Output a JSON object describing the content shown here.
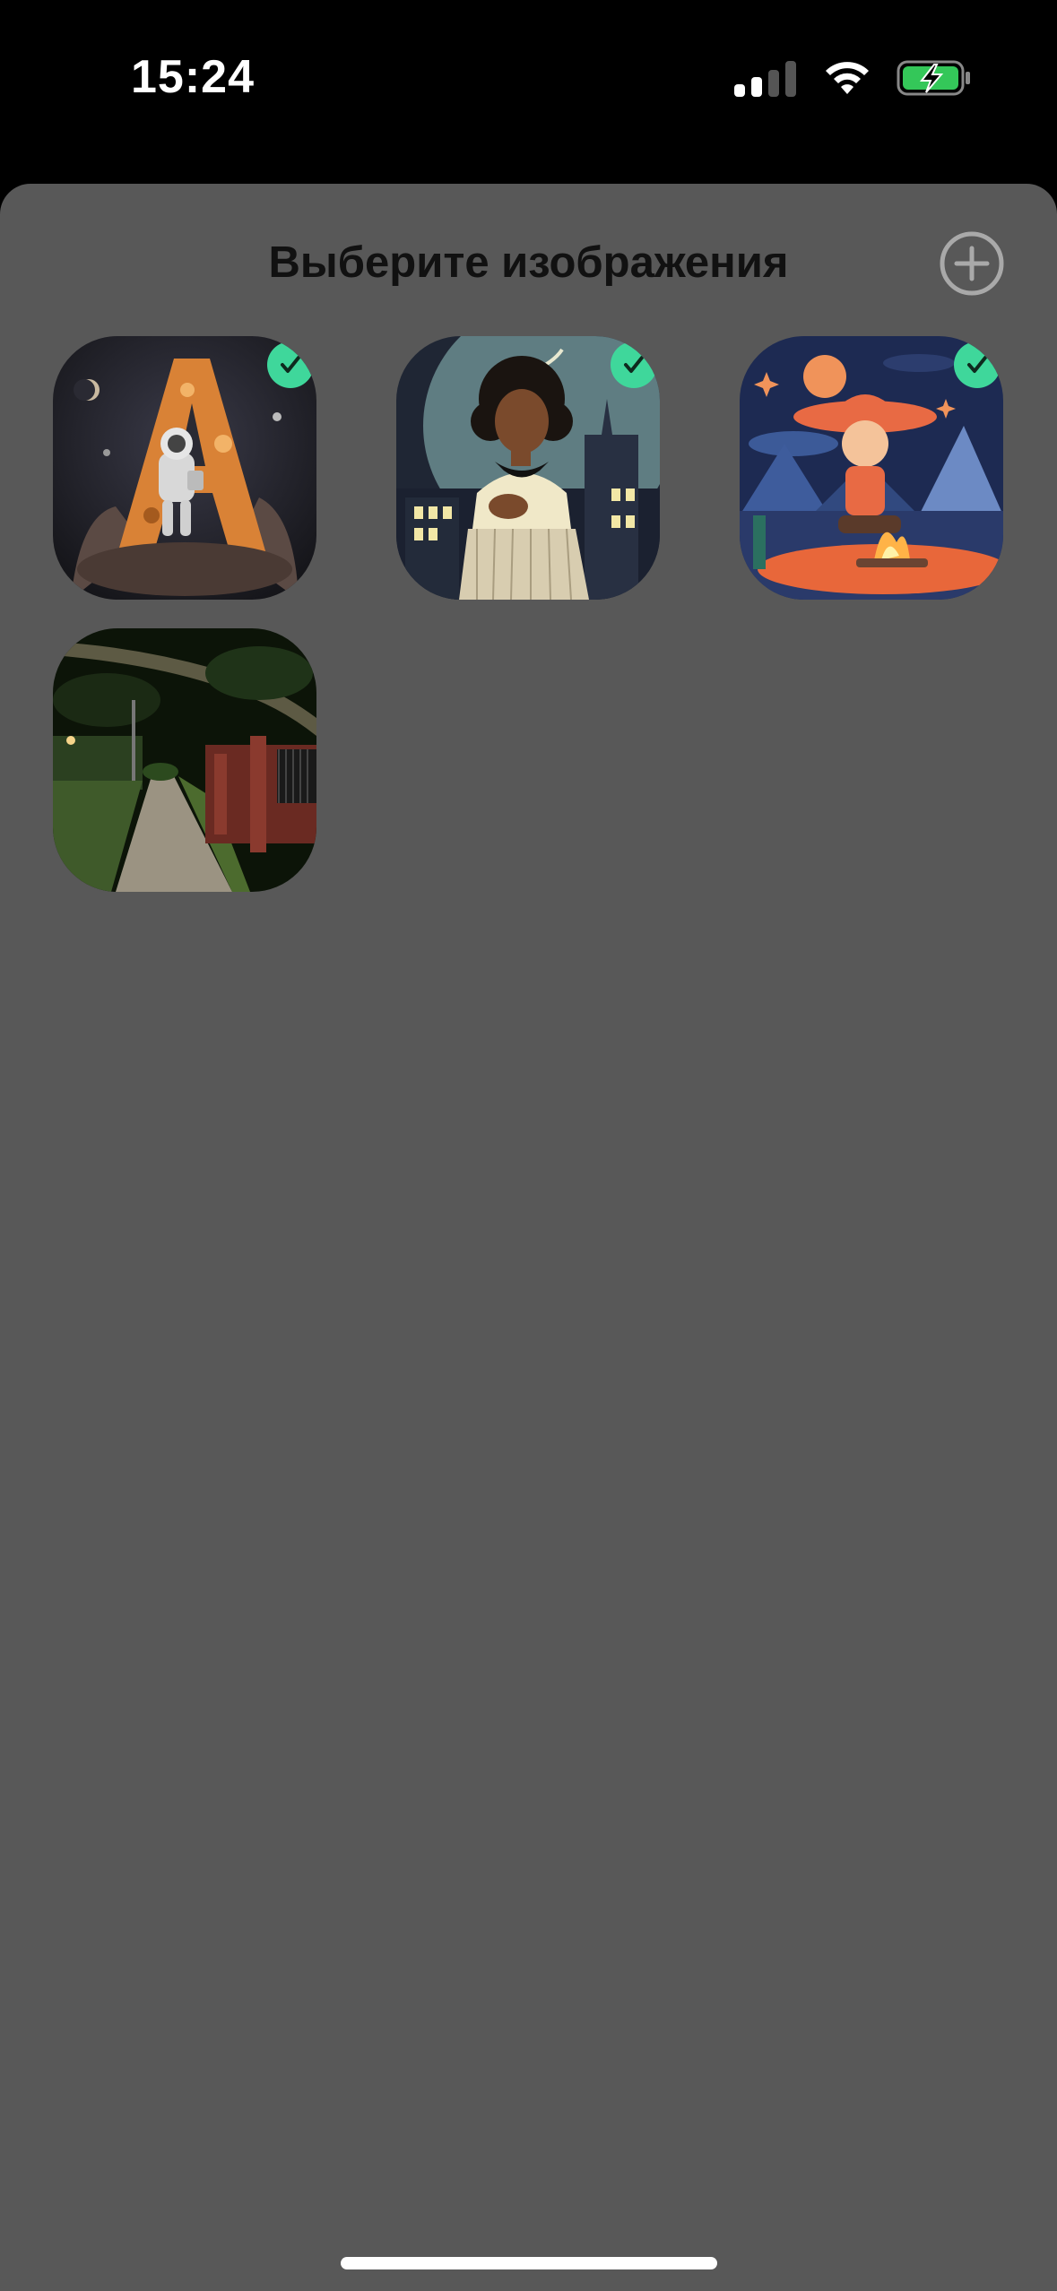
{
  "status_bar": {
    "time": "15:24",
    "signal_bars_active": 2,
    "signal_bars_total": 4,
    "wifi_icon": "wifi-icon",
    "battery_icon": "battery-charging-icon",
    "battery_color": "#34c759"
  },
  "sheet": {
    "title": "Выберите изображения",
    "add_icon": "plus-circle-icon",
    "background": "#585858"
  },
  "images": [
    {
      "subject": "astronaut-letter-a",
      "selected": true
    },
    {
      "subject": "retro-woman-castle",
      "selected": true
    },
    {
      "subject": "cowboy-campfire",
      "selected": true
    },
    {
      "subject": "park-path-night",
      "selected": false
    }
  ],
  "accent_color": "#3fd79b"
}
